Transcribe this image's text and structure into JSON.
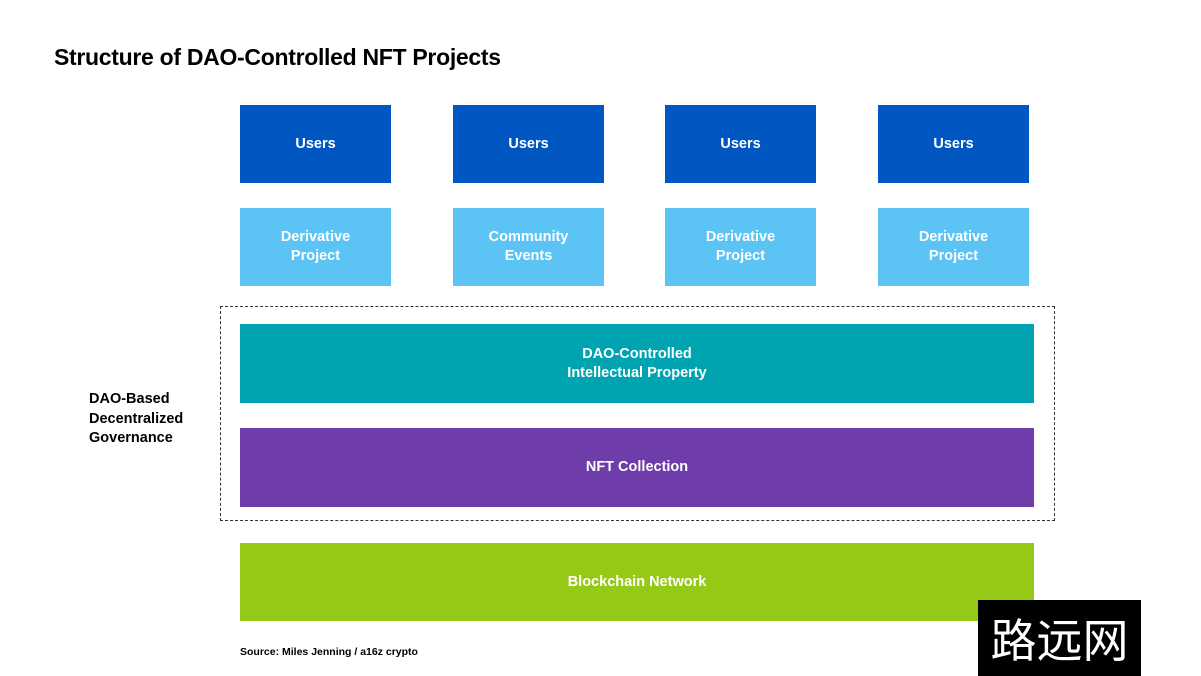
{
  "title": "Structure of DAO-Controlled NFT Projects",
  "colors": {
    "users": "#0057c2",
    "projects": "#5bc4f5",
    "ip": "#00a4b1",
    "nft": "#6f3da9",
    "blockchain": "#95c916"
  },
  "users": [
    "Users",
    "Users",
    "Users",
    "Users"
  ],
  "projects": [
    "Derivative\nProject",
    "Community\nEvents",
    "Derivative\nProject",
    "Derivative\nProject"
  ],
  "governance_label": "DAO-Based\nDecentralized\nGovernance",
  "ip": "DAO-Controlled\nIntellectual Property",
  "nft": "NFT Collection",
  "blockchain": "Blockchain Network",
  "source": "Source: Miles Jenning / a16z crypto",
  "watermark": "路远网"
}
